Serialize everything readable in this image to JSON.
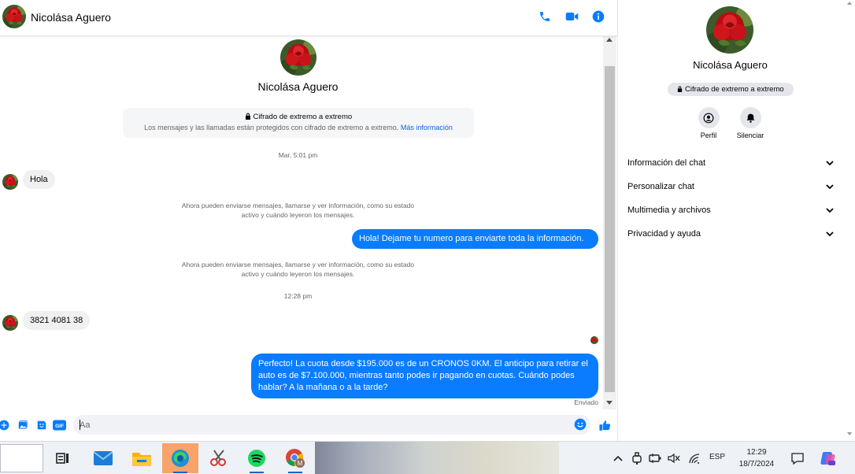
{
  "header": {
    "contact_name": "Nicolása Aguero",
    "icons": [
      "phone-icon",
      "video-camera-icon",
      "info-icon"
    ]
  },
  "conversation": {
    "intro_name": "Nicolása Aguero",
    "e2e_title": "Cifrado de extremo a extremo",
    "e2e_description": "Los mensajes y las llamadas están protegidos con cifrado de extremo a extremo.",
    "e2e_link": "Más información",
    "timestamp_1": "Mar, 5:01 pm",
    "msg_in_1": "Hola",
    "system_msg_1_line1": "Ahora pueden enviarse mensajes, llamarse y ver información, como su estado",
    "system_msg_1_line2": "activo y cuándo leyeron los mensajes.",
    "msg_out_1": "Hola! Dejame tu numero  para enviarte toda la información.",
    "system_msg_2_line1": "Ahora pueden enviarse mensajes, llamarse y ver información, como su estado",
    "system_msg_2_line2": "activo y cuándo leyeron los mensajes.",
    "timestamp_2": "12:28 pm",
    "msg_in_2": "3821 4081 38",
    "msg_out_2_line1": "Perfecto! La cuota desde $195.000 es de un CRONOS 0KM. El anticipo para retirar el",
    "msg_out_2_line2": "auto es de $7.100.000, mientras tanto podes ir pagando en cuotas. Cuándo podes",
    "msg_out_2_line3": "hablar? A la mañana o a la tarde?",
    "delivery_status": "Enviado"
  },
  "composer": {
    "placeholder": "Aa",
    "gif_label": "GIF",
    "icons": [
      "plus-circle-icon",
      "photo-icon",
      "sticker-icon",
      "gif-icon",
      "emoji-icon",
      "thumbs-up-icon"
    ]
  },
  "right_panel": {
    "name": "Nicolása Aguero",
    "e2e_badge": "Cifrado de extremo a extremo",
    "actions": [
      {
        "label": "Perfil",
        "icon": "profile-icon"
      },
      {
        "label": "Silenciar",
        "icon": "bell-icon"
      }
    ],
    "sections": [
      {
        "label": "Información del chat"
      },
      {
        "label": "Personalizar chat"
      },
      {
        "label": "Multimedia y archivos"
      },
      {
        "label": "Privacidad y ayuda"
      }
    ]
  },
  "taskbar": {
    "language": "ESP",
    "time": "12:29",
    "date": "18/7/2024",
    "apps": [
      "task-view",
      "mail",
      "file-explorer",
      "edge",
      "snipping-tool",
      "spotify",
      "chrome"
    ],
    "chrome_badge": "M"
  },
  "colors": {
    "accent": "#0a7cff",
    "bubble_in": "#f0f0f0",
    "link": "#0a64d8"
  }
}
